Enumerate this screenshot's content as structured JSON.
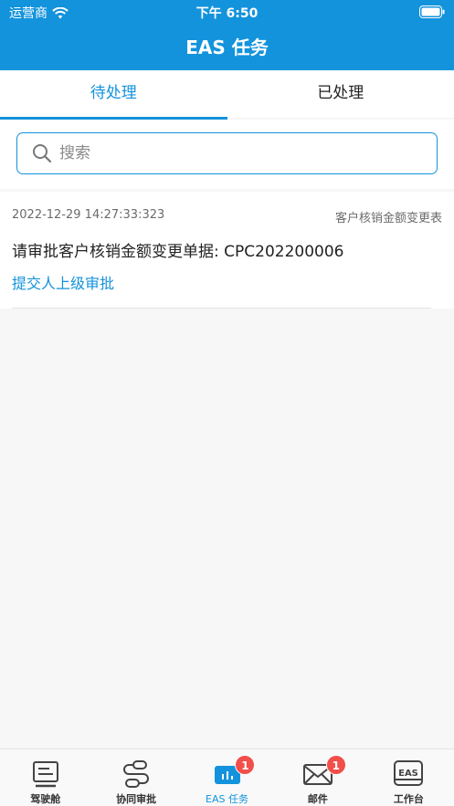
{
  "status_bar": {
    "carrier": "运营商",
    "time": "下午 6:50"
  },
  "nav": {
    "title": "EAS 任务"
  },
  "tabs": [
    {
      "label": "待处理",
      "active": true
    },
    {
      "label": "已处理",
      "active": false
    }
  ],
  "search": {
    "placeholder": "搜索",
    "value": ""
  },
  "tasks": [
    {
      "date": "2022-12-29 14:27:33:323",
      "type": "客户核销金额变更表",
      "title": "请审批客户核销金额变更单据: CPC202200006",
      "step": "提交人上级审批"
    }
  ],
  "tabbar": {
    "items": [
      {
        "label": "驾驶舱",
        "icon": "cockpit-icon"
      },
      {
        "label": "协同审批",
        "icon": "workflow-icon"
      },
      {
        "label": "EAS 任务",
        "icon": "eas-task-icon",
        "badge": "1",
        "active": true
      },
      {
        "label": "邮件",
        "icon": "mail-icon",
        "badge": "1"
      },
      {
        "label": "工作台",
        "icon": "workbench-icon",
        "icon_text": "EAS"
      }
    ]
  },
  "colors": {
    "accent": "#1393dc",
    "badge": "#f24f4a"
  }
}
